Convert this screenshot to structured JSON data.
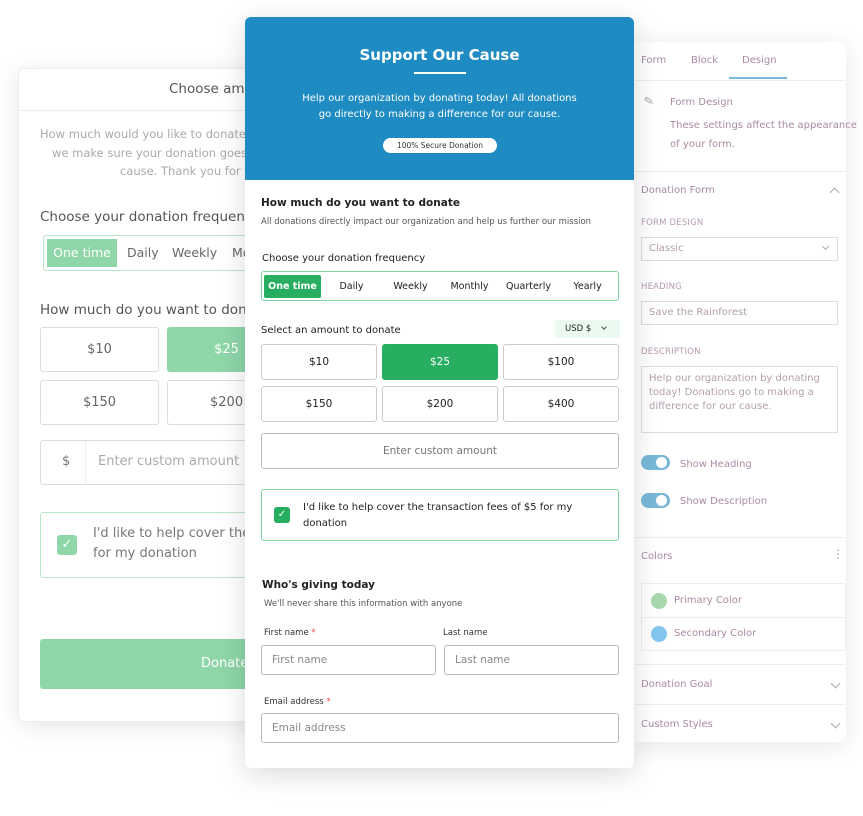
{
  "background_form": {
    "title": "Choose amo",
    "description": [
      "How much would you like to donate",
      "we make sure your donation goes",
      "cause. Thank you for y"
    ],
    "frequency_label": "Choose your donation frequen",
    "frequency_options": [
      "One time",
      "Daily",
      "Weekly",
      "Mo"
    ],
    "amount_label": "How much do you want to don",
    "amounts": [
      "$10",
      "$25",
      "$150",
      "$200"
    ],
    "currency_symbol": "$",
    "custom_placeholder": "Enter custom amount",
    "fee_text": [
      "I'd like to help cover the",
      "for my donation"
    ],
    "donate_label": "Donate",
    "accent": "#8fd6a9"
  },
  "form": {
    "title": "Support Our Cause",
    "description": [
      "Help our organization by donating today! All donations",
      "go directly to making a difference for our cause."
    ],
    "badge": "100% Secure Donation",
    "amount_heading": "How much do you want to donate",
    "amount_sub": "All donations directly impact our organization and help us further our mission",
    "frequency_label": "Choose your donation frequency",
    "frequency_options": [
      "One time",
      "Daily",
      "Weekly",
      "Monthly",
      "Quarterly",
      "Yearly"
    ],
    "frequency_selected": "One time",
    "select_amount_label": "Select an amount to donate",
    "currency": "USD $",
    "amounts": [
      "$10",
      "$25",
      "$100",
      "$150",
      "$200",
      "$400"
    ],
    "amount_selected": "$25",
    "custom_placeholder": "Enter custom amount",
    "fee_text": "I'd like to help cover the transaction fees of $5 for my donation",
    "fee_checked": true,
    "giver_heading": "Who's giving today",
    "giver_sub": "We'll never share this information with anyone",
    "first_name_label": "First name",
    "first_name_placeholder": "First name",
    "last_name_label": "Last name",
    "last_name_placeholder": "Last name",
    "email_label": "Email address",
    "email_placeholder": "Email address",
    "required_mark": "*",
    "header_color": "#1e8bc3",
    "accent": "#27ae60"
  },
  "settings": {
    "tabs": [
      "Form",
      "Block",
      "Design"
    ],
    "active_tab": "Design",
    "section_title": "Form Design",
    "section_desc": [
      "These settings affect the appearance",
      "of your form."
    ],
    "donation_form": "Donation Form",
    "form_design_label": "FORM DESIGN",
    "form_design_value": "Classic",
    "heading_label": "HEADING",
    "heading_value": "Save the Rainforest",
    "description_label": "DESCRIPTION",
    "description_value": "Help our organization by donating today! Donations go to making a difference for our cause.",
    "show_heading": "Show Heading",
    "show_heading_on": true,
    "show_description": "Show Description",
    "show_description_on": true,
    "colors": "Colors",
    "primary_color": "Primary Color",
    "primary_color_value": "#a8d8ae",
    "secondary_color": "Secondary Color",
    "secondary_color_value": "#84c7ee",
    "donation_goal": "Donation Goal",
    "custom_styles": "Custom Styles"
  }
}
